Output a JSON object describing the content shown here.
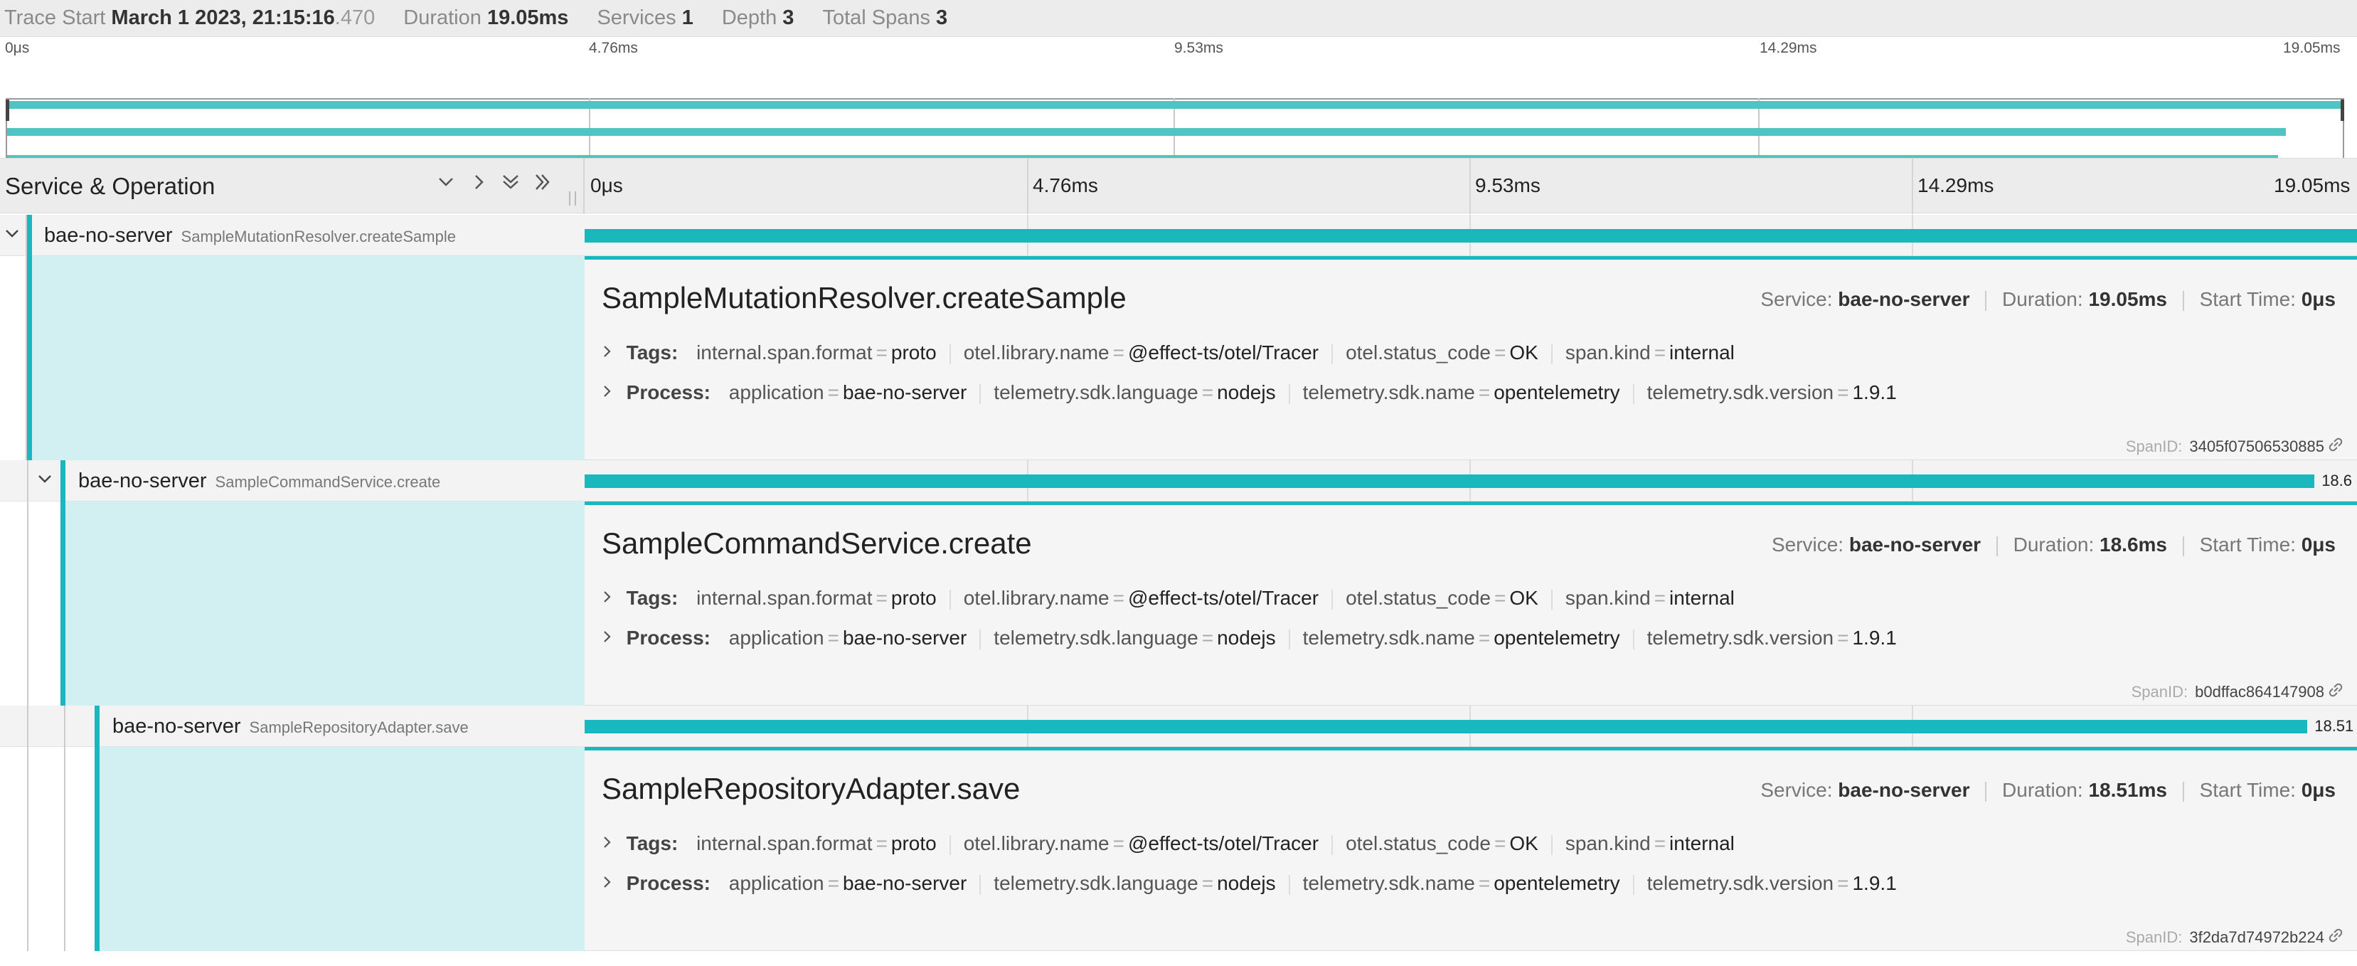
{
  "header": {
    "trace_start_label": "Trace Start",
    "trace_start_date": "March 1 2023, 21:15:16",
    "trace_start_ms": ".470",
    "duration_label": "Duration",
    "duration": "19.05ms",
    "services_label": "Services",
    "services": "1",
    "depth_label": "Depth",
    "depth": "3",
    "total_spans_label": "Total Spans",
    "total_spans": "3"
  },
  "ticks": [
    "0μs",
    "4.76ms",
    "9.53ms",
    "14.29ms",
    "19.05ms"
  ],
  "columns": {
    "service_operation": "Service & Operation",
    "controls": [
      "chevron-down",
      "chevron-right",
      "double-chevron-down",
      "double-chevron-right"
    ]
  },
  "spans": [
    {
      "service": "bae-no-server",
      "operation": "SampleMutationResolver.createSample",
      "bar_start_fraction": 0,
      "bar_fraction": 1.0,
      "bar_label": "",
      "detail": {
        "title": "SampleMutationResolver.createSample",
        "service_label": "Service:",
        "service": "bae-no-server",
        "duration_label": "Duration:",
        "duration": "19.05ms",
        "start_label": "Start Time:",
        "start": "0μs",
        "tags_label": "Tags:",
        "tags": [
          {
            "k": "internal.span.format",
            "v": "proto"
          },
          {
            "k": "otel.library.name",
            "v": "@effect-ts/otel/Tracer"
          },
          {
            "k": "otel.status_code",
            "v": "OK"
          },
          {
            "k": "span.kind",
            "v": "internal"
          }
        ],
        "process_label": "Process:",
        "process": [
          {
            "k": "application",
            "v": "bae-no-server"
          },
          {
            "k": "telemetry.sdk.language",
            "v": "nodejs"
          },
          {
            "k": "telemetry.sdk.name",
            "v": "opentelemetry"
          },
          {
            "k": "telemetry.sdk.version",
            "v": "1.9.1"
          }
        ],
        "span_id_label": "SpanID:",
        "span_id": "3405f07506530885"
      }
    },
    {
      "service": "bae-no-server",
      "operation": "SampleCommandService.create",
      "bar_start_fraction": 0,
      "bar_fraction": 0.976,
      "bar_label": "18.6",
      "detail": {
        "title": "SampleCommandService.create",
        "service_label": "Service:",
        "service": "bae-no-server",
        "duration_label": "Duration:",
        "duration": "18.6ms",
        "start_label": "Start Time:",
        "start": "0μs",
        "tags_label": "Tags:",
        "tags": [
          {
            "k": "internal.span.format",
            "v": "proto"
          },
          {
            "k": "otel.library.name",
            "v": "@effect-ts/otel/Tracer"
          },
          {
            "k": "otel.status_code",
            "v": "OK"
          },
          {
            "k": "span.kind",
            "v": "internal"
          }
        ],
        "process_label": "Process:",
        "process": [
          {
            "k": "application",
            "v": "bae-no-server"
          },
          {
            "k": "telemetry.sdk.language",
            "v": "nodejs"
          },
          {
            "k": "telemetry.sdk.name",
            "v": "opentelemetry"
          },
          {
            "k": "telemetry.sdk.version",
            "v": "1.9.1"
          }
        ],
        "span_id_label": "SpanID:",
        "span_id": "b0dffac864147908"
      }
    },
    {
      "service": "bae-no-server",
      "operation": "SampleRepositoryAdapter.save",
      "bar_start_fraction": 0,
      "bar_fraction": 0.972,
      "bar_label": "18.51",
      "detail": {
        "title": "SampleRepositoryAdapter.save",
        "service_label": "Service:",
        "service": "bae-no-server",
        "duration_label": "Duration:",
        "duration": "18.51ms",
        "start_label": "Start Time:",
        "start": "0μs",
        "tags_label": "Tags:",
        "tags": [
          {
            "k": "internal.span.format",
            "v": "proto"
          },
          {
            "k": "otel.library.name",
            "v": "@effect-ts/otel/Tracer"
          },
          {
            "k": "otel.status_code",
            "v": "OK"
          },
          {
            "k": "span.kind",
            "v": "internal"
          }
        ],
        "process_label": "Process:",
        "process": [
          {
            "k": "application",
            "v": "bae-no-server"
          },
          {
            "k": "telemetry.sdk.language",
            "v": "nodejs"
          },
          {
            "k": "telemetry.sdk.name",
            "v": "opentelemetry"
          },
          {
            "k": "telemetry.sdk.version",
            "v": "1.9.1"
          }
        ],
        "span_id_label": "SpanID:",
        "span_id": "3f2da7d74972b224"
      }
    }
  ],
  "colors": {
    "accent": "#19b8be",
    "minimap_bar": "#4fc4c4",
    "detail_left_fill": "#d2eff1"
  }
}
